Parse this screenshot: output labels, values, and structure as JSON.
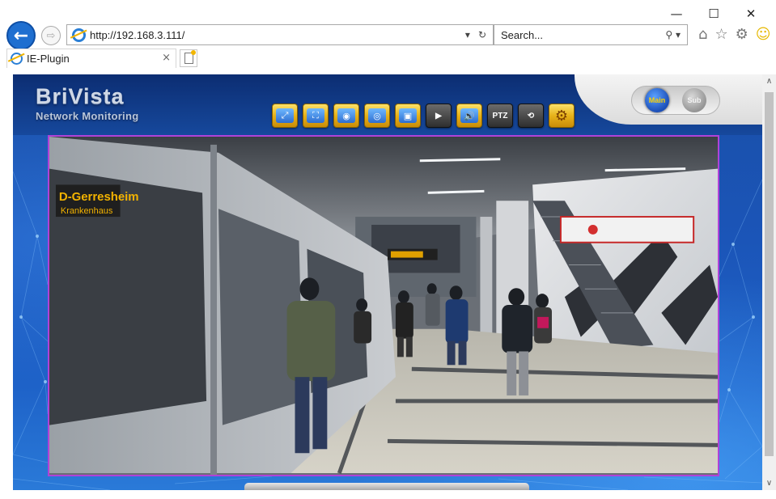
{
  "window": {
    "minimize": "—",
    "maximize": "☐",
    "close": "✕"
  },
  "browser": {
    "address": "http://192.168.3.111/",
    "address_dropdown": "▾",
    "refresh": "↻",
    "search_placeholder": "Search...",
    "search_icon": "⚲",
    "search_dropdown": "▾",
    "back_glyph": "←",
    "forward_glyph": "⇨",
    "home_icon": "⌂",
    "favorites_icon": "☆",
    "settings_icon": "⚙",
    "feedback_icon": "☺",
    "tab_title": "IE-Plugin",
    "tab_close": "×"
  },
  "app": {
    "logo_title": "BriVista",
    "logo_subtitle": "Network Monitoring",
    "stream_main": "Main",
    "stream_sub": "Sub",
    "toolbar": [
      {
        "id": "snapshot",
        "glyph": "⤢",
        "style": "blue"
      },
      {
        "id": "fullscreen",
        "glyph": "⛶",
        "style": "blue"
      },
      {
        "id": "record",
        "glyph": "◉",
        "style": "blue"
      },
      {
        "id": "zoom",
        "glyph": "◎",
        "style": "blue"
      },
      {
        "id": "playback",
        "glyph": "▣",
        "style": "blue"
      },
      {
        "id": "camera",
        "glyph": "▶",
        "style": "dark"
      },
      {
        "id": "audio",
        "glyph": "🔊",
        "style": "blue"
      },
      {
        "id": "ptz",
        "glyph": "PTZ",
        "style": "dark"
      },
      {
        "id": "history",
        "glyph": "⟲",
        "style": "dark"
      },
      {
        "id": "settings",
        "glyph": "⚙",
        "style": "gold"
      }
    ],
    "video_signage": {
      "train_destination": "D-Gerresheim",
      "train_line": "Krankenhaus"
    }
  },
  "colors": {
    "frame_border": "#b042d8",
    "brand_blue": "#1b55b8",
    "tool_gold": "#e7b21a"
  }
}
